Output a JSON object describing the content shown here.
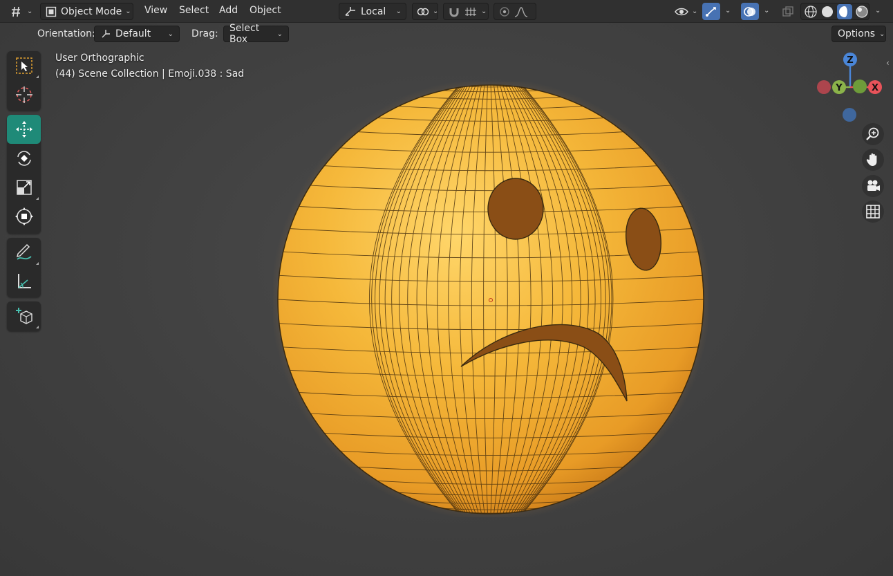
{
  "header": {
    "mode_label": "Object Mode",
    "menus": [
      "View",
      "Select",
      "Add",
      "Object"
    ],
    "transform_orientation": "Local",
    "icons": {
      "editor_type": "editor-type-icon",
      "mode": "object-mode-icon",
      "pivot": "pivot-point-icon",
      "snap": "snap-magnet-icon",
      "snap_increment": "snap-increment-icon",
      "proportional": "proportional-editing-icon",
      "falloff": "falloff-curve-icon",
      "visibility": "visibility-eye-icon",
      "gizmos": "gizmo-icon",
      "overlays": "overlays-icon",
      "xray": "xray-icon",
      "shading_wire": "wireframe-shading-icon",
      "shading_solid": "solid-shading-icon",
      "shading_material": "material-shading-icon",
      "shading_rendered": "rendered-shading-icon"
    }
  },
  "tool_settings": {
    "orientation_label": "Orientation:",
    "orientation_value": "Default",
    "drag_label": "Drag:",
    "drag_value": "Select Box",
    "options_label": "Options"
  },
  "overlay": {
    "view_name": "User Orthographic",
    "object_info": "(44) Scene Collection | Emoji.038 : Sad"
  },
  "gizmo": {
    "z_label": "Z",
    "y_label": "Y",
    "x_label": "X",
    "colors": {
      "x": "#e8535a",
      "y": "#8bb34a",
      "z": "#4a86d8",
      "x_neg": "#c04650",
      "y_neg": "#6e9c3a",
      "z_neg": "#3f6fae"
    }
  },
  "tools": [
    "select-box-icon",
    "cursor-icon",
    "move-icon",
    "rotate-icon",
    "scale-icon",
    "transform-icon",
    "annotate-icon",
    "measure-icon",
    "add-cube-icon"
  ],
  "nav_buttons": [
    "zoom-icon",
    "pan-hand-icon",
    "camera-icon",
    "grid-icon"
  ],
  "colors": {
    "accent_active_tool": "#1f8a78",
    "emoji_face": "#f3b73a",
    "emoji_shadow": "#d7891f",
    "header_bg": "#303030",
    "viewport_bg": "#404040"
  }
}
